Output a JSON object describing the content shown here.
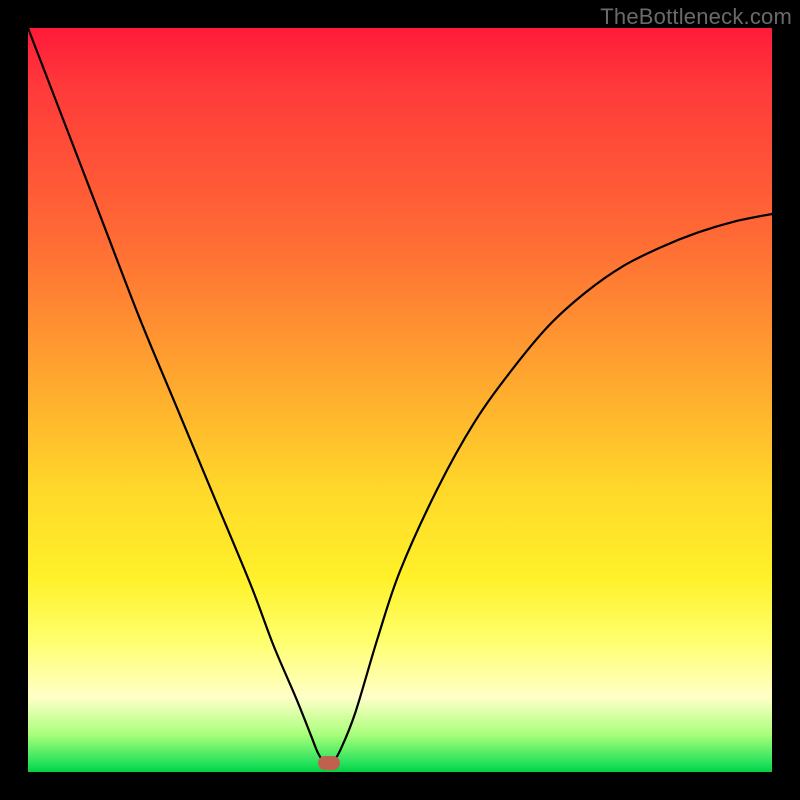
{
  "watermark": "TheBottleneck.com",
  "colors": {
    "frame": "#000000",
    "gradient_top": "#ff1a3a",
    "gradient_mid": "#ffd82a",
    "gradient_bottom": "#00d040",
    "curve": "#000000",
    "marker": "#c0604e"
  },
  "chart_data": {
    "type": "line",
    "title": "",
    "xlabel": "",
    "ylabel": "",
    "xlim": [
      0,
      100
    ],
    "ylim": [
      0,
      100
    ],
    "legend": false,
    "grid": false,
    "annotations": [
      {
        "kind": "marker",
        "shape": "rounded-rect",
        "x": 41,
        "y": 1.5,
        "color": "#c0604e"
      }
    ],
    "series": [
      {
        "name": "bottleneck-curve",
        "x": [
          0,
          5,
          10,
          15,
          20,
          25,
          30,
          33,
          36,
          38,
          39,
          40,
          41,
          42,
          44,
          47,
          50,
          55,
          60,
          65,
          70,
          75,
          80,
          85,
          90,
          95,
          100
        ],
        "y": [
          100,
          87,
          74,
          61,
          49,
          37,
          25,
          17,
          10,
          5,
          2.5,
          1.2,
          1.5,
          3,
          8,
          18,
          27,
          38,
          47,
          54,
          60,
          64.5,
          68,
          70.5,
          72.5,
          74,
          75
        ]
      }
    ],
    "minimum": {
      "x": 40.5,
      "y": 1.2
    }
  }
}
